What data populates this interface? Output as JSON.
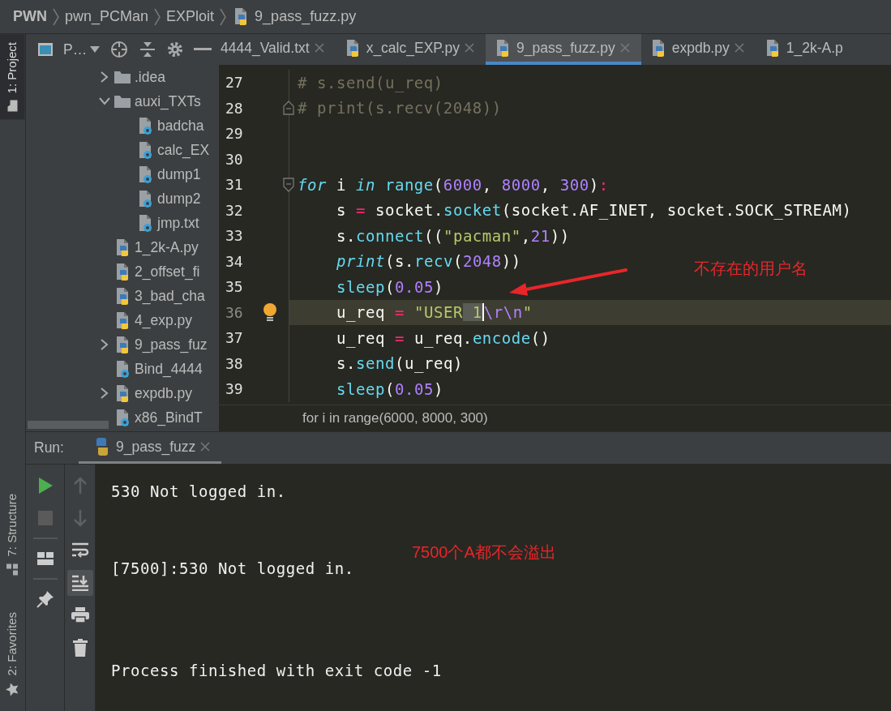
{
  "breadcrumbs": [
    {
      "label": "PWN",
      "kind": "project"
    },
    {
      "label": "pwn_PCMan",
      "kind": "folder"
    },
    {
      "label": "EXPloit",
      "kind": "folder"
    },
    {
      "label": "9_pass_fuzz.py",
      "kind": "python"
    }
  ],
  "tool_strip": {
    "top": [
      {
        "label": "1: Project",
        "kind": "project",
        "selected": true
      }
    ],
    "bottom": [
      {
        "label": "7: Structure",
        "kind": "structure",
        "selected": false
      },
      {
        "label": "2: Favorites",
        "kind": "favorites",
        "selected": false
      }
    ]
  },
  "project_panel": {
    "view_label": "P…",
    "tree": [
      {
        "label": ".idea",
        "kind": "folder",
        "expanded": false
      },
      {
        "label": "auxi_TXTs",
        "kind": "folder",
        "expanded": true,
        "children": [
          {
            "label": "badcha",
            "kind": "config"
          },
          {
            "label": "calc_EX",
            "kind": "config"
          },
          {
            "label": "dump1",
            "kind": "config"
          },
          {
            "label": "dump2",
            "kind": "config"
          },
          {
            "label": "jmp.txt",
            "kind": "config"
          }
        ]
      },
      {
        "label": "1_2k-A.py",
        "kind": "python"
      },
      {
        "label": "2_offset_fi",
        "kind": "python"
      },
      {
        "label": "3_bad_cha",
        "kind": "python"
      },
      {
        "label": "4_exp.py",
        "kind": "python"
      },
      {
        "label": "9_pass_fuz",
        "kind": "python",
        "expanded": false
      },
      {
        "label": "Bind_4444",
        "kind": "config"
      },
      {
        "label": "expdb.py",
        "kind": "python",
        "expanded": false
      },
      {
        "label": "x86_BindT",
        "kind": "config"
      }
    ]
  },
  "editor": {
    "tabs": [
      {
        "label": "4444_Valid.txt",
        "kind": "text",
        "selected": false
      },
      {
        "label": "x_calc_EXP.py",
        "kind": "python",
        "selected": false
      },
      {
        "label": "9_pass_fuzz.py",
        "kind": "python",
        "selected": true
      },
      {
        "label": "expdb.py",
        "kind": "python",
        "selected": false
      },
      {
        "label": "1_2k-A.p",
        "kind": "python",
        "selected": false
      }
    ],
    "lines": [
      {
        "number": "27",
        "indented": false,
        "current": false,
        "fold_start": false,
        "fold_end": false,
        "tokens": [
          {
            "text": "# s.send(u_req)",
            "kind": "comment"
          }
        ]
      },
      {
        "number": "28",
        "indented": false,
        "current": false,
        "fold_start": false,
        "fold_end": true,
        "tokens": [
          {
            "text": "# print(s.recv(2048))",
            "kind": "comment"
          }
        ]
      },
      {
        "number": "29",
        "current": false,
        "fold_start": false,
        "fold_end": false
      },
      {
        "number": "30",
        "current": false,
        "fold_start": false,
        "fold_end": false
      },
      {
        "number": "31",
        "indented": false,
        "current": false,
        "fold_start": true,
        "fold_end": false,
        "tokens": [
          {
            "text": "for",
            "kind": "keyword"
          },
          {
            "text": " i ",
            "kind": "plain"
          },
          {
            "text": "in ",
            "kind": "keyword"
          },
          {
            "text": "range",
            "kind": "call"
          },
          {
            "text": "(",
            "kind": "plain"
          },
          {
            "text": "6000",
            "kind": "number"
          },
          {
            "text": ", ",
            "kind": "plain"
          },
          {
            "text": "8000",
            "kind": "number"
          },
          {
            "text": ", ",
            "kind": "plain"
          },
          {
            "text": "300",
            "kind": "number"
          },
          {
            "text": ")",
            "kind": "plain"
          },
          {
            "text": ":",
            "kind": "op"
          }
        ]
      },
      {
        "number": "32",
        "indented": true,
        "current": false,
        "tokens": [
          {
            "text": "s ",
            "kind": "plain"
          },
          {
            "text": "=",
            "kind": "op"
          },
          {
            "text": " socket.",
            "kind": "plain"
          },
          {
            "text": "socket",
            "kind": "call"
          },
          {
            "text": "(socket.AF_INET, socket.SOCK_STREAM)",
            "kind": "plain"
          }
        ]
      },
      {
        "number": "33",
        "indented": true,
        "current": false,
        "tokens": [
          {
            "text": "s.",
            "kind": "plain"
          },
          {
            "text": "connect",
            "kind": "call"
          },
          {
            "text": "((",
            "kind": "plain"
          },
          {
            "text": "\"pacman\"",
            "kind": "string"
          },
          {
            "text": ",",
            "kind": "plain"
          },
          {
            "text": "21",
            "kind": "number"
          },
          {
            "text": "))",
            "kind": "plain"
          }
        ]
      },
      {
        "number": "34",
        "indented": true,
        "current": false,
        "tokens": [
          {
            "text": "print",
            "kind": "builtin"
          },
          {
            "text": "(s.",
            "kind": "plain"
          },
          {
            "text": "recv",
            "kind": "call"
          },
          {
            "text": "(",
            "kind": "plain"
          },
          {
            "text": "2048",
            "kind": "number"
          },
          {
            "text": "))",
            "kind": "plain"
          }
        ]
      },
      {
        "number": "35",
        "indented": true,
        "current": false,
        "tokens": [
          {
            "text": "sleep",
            "kind": "call"
          },
          {
            "text": "(",
            "kind": "plain"
          },
          {
            "text": "0.05",
            "kind": "number"
          },
          {
            "text": ")",
            "kind": "plain"
          }
        ]
      },
      {
        "number": "36",
        "indented": true,
        "current": true,
        "tokens": [
          {
            "text": "u_req ",
            "kind": "plain"
          },
          {
            "text": "= ",
            "kind": "op"
          },
          {
            "text": "\"USER",
            "kind": "string"
          },
          {
            "text": " 1",
            "kind": "selected"
          },
          {
            "text": "\\r\\n",
            "kind": "escape"
          },
          {
            "text": "\"",
            "kind": "string"
          }
        ]
      },
      {
        "number": "37",
        "indented": true,
        "current": false,
        "tokens": [
          {
            "text": "u_req ",
            "kind": "plain"
          },
          {
            "text": "=",
            "kind": "op"
          },
          {
            "text": " u_req.",
            "kind": "plain"
          },
          {
            "text": "encode",
            "kind": "call"
          },
          {
            "text": "()",
            "kind": "plain"
          }
        ]
      },
      {
        "number": "38",
        "indented": true,
        "current": false,
        "tokens": [
          {
            "text": "s.",
            "kind": "plain"
          },
          {
            "text": "send",
            "kind": "call"
          },
          {
            "text": "(u_req)",
            "kind": "plain"
          }
        ]
      },
      {
        "number": "39",
        "indented": true,
        "current": false,
        "tokens": [
          {
            "text": "sleep",
            "kind": "call"
          },
          {
            "text": "(",
            "kind": "plain"
          },
          {
            "text": "0.05",
            "kind": "number"
          },
          {
            "text": ")",
            "kind": "plain"
          }
        ]
      }
    ],
    "footer": "for i in range(6000, 8000, 300)"
  },
  "annotations": [
    {
      "kind": "arrow"
    },
    {
      "kind": "note",
      "text": "不存在的用户名"
    },
    {
      "kind": "console_note",
      "text": "7500个A都不会溢出"
    }
  ],
  "run_panel": {
    "title": "Run:",
    "tab": "9_pass_fuzz",
    "autoscroll": true,
    "console": [
      {
        "text": "530 Not logged in.",
        "kind": "output"
      },
      {
        "text": "[7500]:530 Not logged in.",
        "kind": "output"
      },
      {
        "text": "Process finished with exit code -1",
        "kind": "exit"
      }
    ]
  }
}
